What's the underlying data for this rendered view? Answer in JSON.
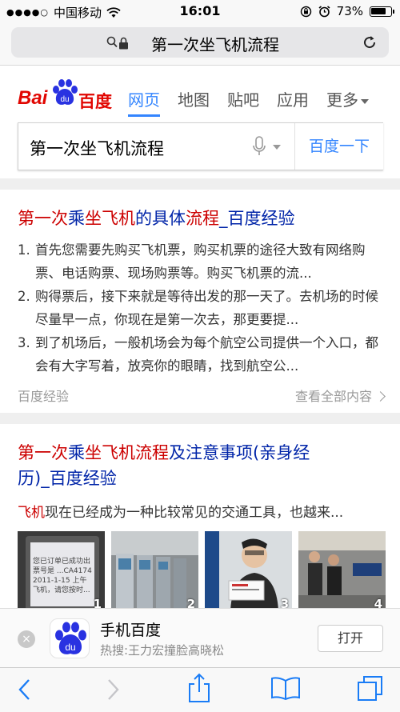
{
  "status_bar": {
    "carrier": "中国移动",
    "time": "16:01",
    "battery": "73%"
  },
  "browser": {
    "url_text": "第一次坐飞机流程"
  },
  "baidu": {
    "logo_latin": "Bai",
    "logo_paw_text": "du",
    "logo_cn": "百度",
    "nav": [
      "网页",
      "地图",
      "贴吧",
      "应用",
      "更多"
    ],
    "active_nav": "网页",
    "query": "第一次坐飞机流程",
    "submit_label": "百度一下"
  },
  "results": [
    {
      "title_parts": [
        {
          "text": "第一次",
          "hl": true
        },
        {
          "text": "乘",
          "hl": false
        },
        {
          "text": "坐飞机",
          "hl": true
        },
        {
          "text": "的具体",
          "hl": false
        },
        {
          "text": "流程",
          "hl": true
        },
        {
          "text": "_百度经验",
          "hl": false
        }
      ],
      "steps": [
        {
          "num": "1.",
          "text": "首先您需要先购买飞机票，购买机票的途径大致有网络购票、电话购票、现场购票等。购买飞机票的流..."
        },
        {
          "num": "2.",
          "text": "购得票后，接下来就是等待出发的那一天了。去机场的时候尽量早一点，你现在是第一次去，那更要提..."
        },
        {
          "num": "3.",
          "text": "到了机场后，一般机场会为每个航空公司提供一个入口，都会有大字写着，放亮你的眼睛，找到航空公..."
        }
      ],
      "source": "百度经验",
      "more": "查看全部内容"
    },
    {
      "title_line1": [
        {
          "text": "第一次",
          "hl": true
        },
        {
          "text": "乘",
          "hl": false
        },
        {
          "text": "坐飞机流程",
          "hl": true
        },
        {
          "text": "及注意事项(亲身经",
          "hl": false
        }
      ],
      "title_line2": "历)_百度经验",
      "snippet_hl": "飞机",
      "snippet_rest": "现在已经成为一种比较常见的交通工具，也越来...",
      "thumb_numbers": [
        "1",
        "2",
        "3",
        "4"
      ],
      "thumb1_text": [
        "您已订单已成功出",
        "票号是 ...CA4174",
        "2011-1-15 上午",
        "飞机，请您按时..."
      ]
    }
  ],
  "app_banner": {
    "name": "手机百度",
    "hot": "热搜:王力宏撞脸高晓松",
    "open_label": "打开",
    "close_glyph": "×"
  },
  "colors": {
    "baidu_red": "#e10601",
    "link_blue": "#0024a8",
    "accent_blue": "#3385ff",
    "highlight_red": "#cc0000"
  }
}
